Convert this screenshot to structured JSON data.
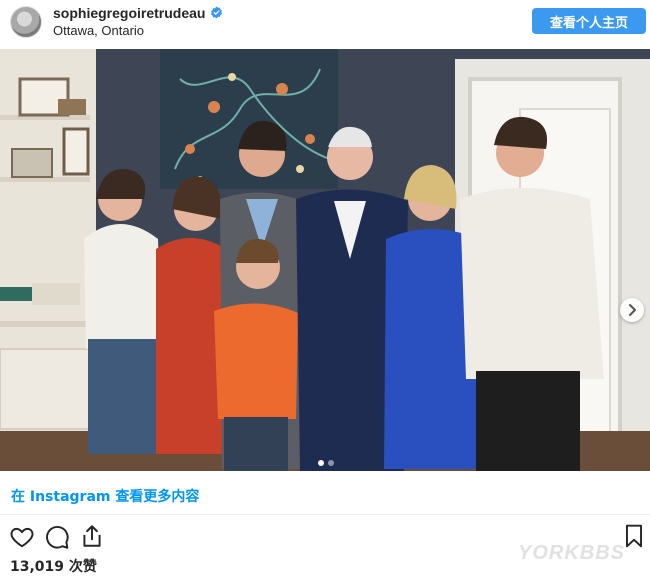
{
  "post": {
    "username": "sophiegregoiretrudeau",
    "location": "Ottawa, Ontario",
    "profile_button_label": "查看个人主页",
    "more_on_instagram": "在 Instagram 查看更多内容",
    "likes": "13,019 次赞",
    "watermark": "YORKBBS",
    "carousel": {
      "current_slide": 1,
      "total_slides": 2
    }
  },
  "icons": {
    "verified": "verified-badge-icon",
    "like": "heart-icon",
    "comment": "comment-bubble-icon",
    "share": "share-icon",
    "save": "bookmark-icon",
    "next": "chevron-right-icon"
  },
  "colors": {
    "accent": "#0095f6",
    "button": "#3b99f0",
    "text": "#262626"
  }
}
